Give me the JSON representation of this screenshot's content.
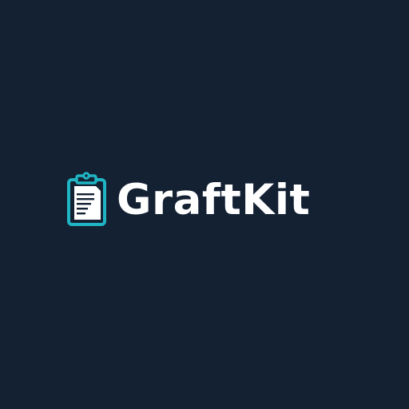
{
  "brand": {
    "name": "GraftKit",
    "icon": "clipboard-document-icon",
    "colors": {
      "background": "#132133",
      "accent": "#20b5c4",
      "text": "#ffffff"
    }
  }
}
